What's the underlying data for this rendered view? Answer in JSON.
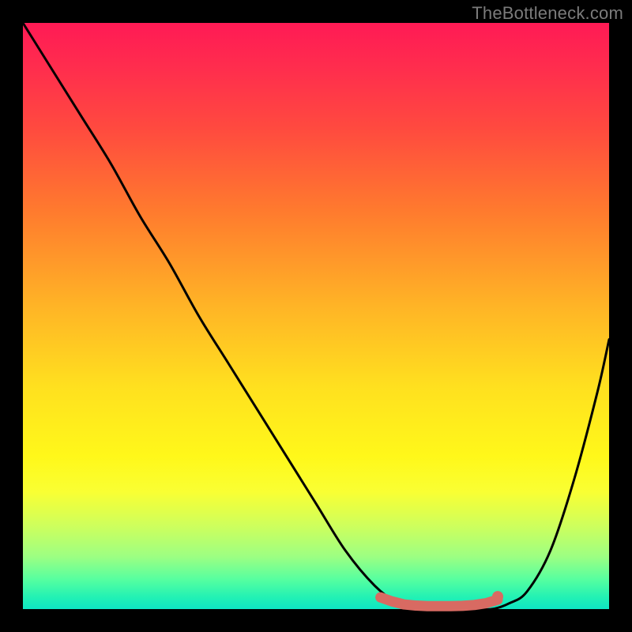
{
  "watermark": "TheBottleneck.com",
  "colors": {
    "frame": "#000000",
    "curve_stroke": "#000000",
    "marker_fill": "#d86a62",
    "gradient_top": "#ff1a55",
    "gradient_bottom": "#0ee6c4"
  },
  "chart_data": {
    "type": "line",
    "title": "",
    "xlabel": "",
    "ylabel": "",
    "xlim": [
      0,
      100
    ],
    "ylim": [
      0,
      100
    ],
    "series": [
      {
        "name": "bottleneck-curve",
        "x": [
          0,
          5,
          10,
          15,
          20,
          25,
          30,
          35,
          40,
          45,
          50,
          55,
          60,
          64,
          68,
          72,
          76,
          80,
          83,
          86,
          90,
          94,
          98,
          100
        ],
        "values": [
          100,
          92,
          84,
          76,
          67,
          59,
          50,
          42,
          34,
          26,
          18,
          10,
          4,
          1,
          0,
          0,
          0,
          0,
          1,
          3,
          10,
          22,
          37,
          46
        ]
      },
      {
        "name": "flat-region-markers",
        "x": [
          61,
          63,
          65,
          67,
          69,
          71,
          73,
          75,
          77,
          79,
          81
        ],
        "values": [
          2,
          1.3,
          0.8,
          0.6,
          0.5,
          0.5,
          0.5,
          0.55,
          0.7,
          1.0,
          1.6
        ]
      }
    ],
    "annotations": []
  }
}
